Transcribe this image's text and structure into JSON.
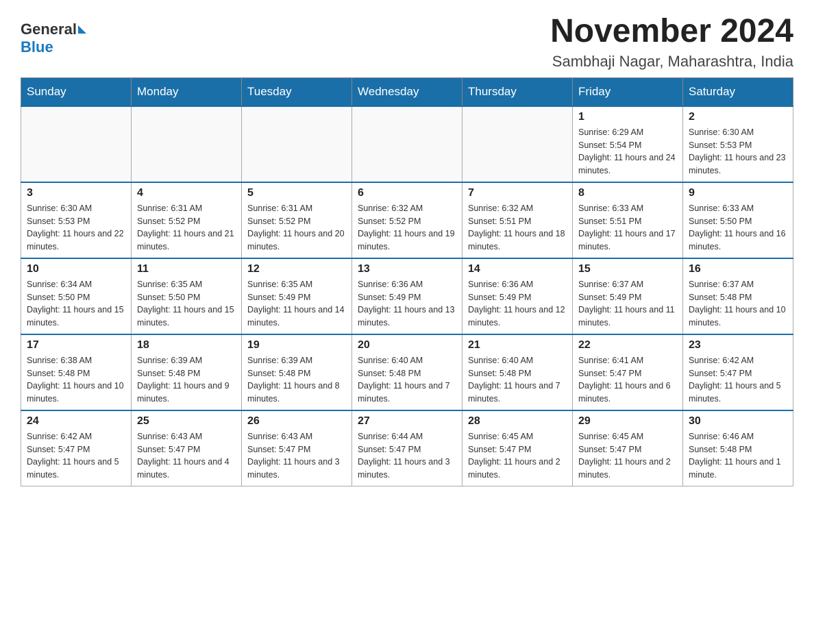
{
  "header": {
    "logo": {
      "general": "General",
      "triangle": "▶",
      "blue": "Blue"
    },
    "month_title": "November 2024",
    "location": "Sambhaji Nagar, Maharashtra, India"
  },
  "days_of_week": [
    "Sunday",
    "Monday",
    "Tuesday",
    "Wednesday",
    "Thursday",
    "Friday",
    "Saturday"
  ],
  "weeks": [
    [
      {
        "day": "",
        "info": ""
      },
      {
        "day": "",
        "info": ""
      },
      {
        "day": "",
        "info": ""
      },
      {
        "day": "",
        "info": ""
      },
      {
        "day": "",
        "info": ""
      },
      {
        "day": "1",
        "info": "Sunrise: 6:29 AM\nSunset: 5:54 PM\nDaylight: 11 hours and 24 minutes."
      },
      {
        "day": "2",
        "info": "Sunrise: 6:30 AM\nSunset: 5:53 PM\nDaylight: 11 hours and 23 minutes."
      }
    ],
    [
      {
        "day": "3",
        "info": "Sunrise: 6:30 AM\nSunset: 5:53 PM\nDaylight: 11 hours and 22 minutes."
      },
      {
        "day": "4",
        "info": "Sunrise: 6:31 AM\nSunset: 5:52 PM\nDaylight: 11 hours and 21 minutes."
      },
      {
        "day": "5",
        "info": "Sunrise: 6:31 AM\nSunset: 5:52 PM\nDaylight: 11 hours and 20 minutes."
      },
      {
        "day": "6",
        "info": "Sunrise: 6:32 AM\nSunset: 5:52 PM\nDaylight: 11 hours and 19 minutes."
      },
      {
        "day": "7",
        "info": "Sunrise: 6:32 AM\nSunset: 5:51 PM\nDaylight: 11 hours and 18 minutes."
      },
      {
        "day": "8",
        "info": "Sunrise: 6:33 AM\nSunset: 5:51 PM\nDaylight: 11 hours and 17 minutes."
      },
      {
        "day": "9",
        "info": "Sunrise: 6:33 AM\nSunset: 5:50 PM\nDaylight: 11 hours and 16 minutes."
      }
    ],
    [
      {
        "day": "10",
        "info": "Sunrise: 6:34 AM\nSunset: 5:50 PM\nDaylight: 11 hours and 15 minutes."
      },
      {
        "day": "11",
        "info": "Sunrise: 6:35 AM\nSunset: 5:50 PM\nDaylight: 11 hours and 15 minutes."
      },
      {
        "day": "12",
        "info": "Sunrise: 6:35 AM\nSunset: 5:49 PM\nDaylight: 11 hours and 14 minutes."
      },
      {
        "day": "13",
        "info": "Sunrise: 6:36 AM\nSunset: 5:49 PM\nDaylight: 11 hours and 13 minutes."
      },
      {
        "day": "14",
        "info": "Sunrise: 6:36 AM\nSunset: 5:49 PM\nDaylight: 11 hours and 12 minutes."
      },
      {
        "day": "15",
        "info": "Sunrise: 6:37 AM\nSunset: 5:49 PM\nDaylight: 11 hours and 11 minutes."
      },
      {
        "day": "16",
        "info": "Sunrise: 6:37 AM\nSunset: 5:48 PM\nDaylight: 11 hours and 10 minutes."
      }
    ],
    [
      {
        "day": "17",
        "info": "Sunrise: 6:38 AM\nSunset: 5:48 PM\nDaylight: 11 hours and 10 minutes."
      },
      {
        "day": "18",
        "info": "Sunrise: 6:39 AM\nSunset: 5:48 PM\nDaylight: 11 hours and 9 minutes."
      },
      {
        "day": "19",
        "info": "Sunrise: 6:39 AM\nSunset: 5:48 PM\nDaylight: 11 hours and 8 minutes."
      },
      {
        "day": "20",
        "info": "Sunrise: 6:40 AM\nSunset: 5:48 PM\nDaylight: 11 hours and 7 minutes."
      },
      {
        "day": "21",
        "info": "Sunrise: 6:40 AM\nSunset: 5:48 PM\nDaylight: 11 hours and 7 minutes."
      },
      {
        "day": "22",
        "info": "Sunrise: 6:41 AM\nSunset: 5:47 PM\nDaylight: 11 hours and 6 minutes."
      },
      {
        "day": "23",
        "info": "Sunrise: 6:42 AM\nSunset: 5:47 PM\nDaylight: 11 hours and 5 minutes."
      }
    ],
    [
      {
        "day": "24",
        "info": "Sunrise: 6:42 AM\nSunset: 5:47 PM\nDaylight: 11 hours and 5 minutes."
      },
      {
        "day": "25",
        "info": "Sunrise: 6:43 AM\nSunset: 5:47 PM\nDaylight: 11 hours and 4 minutes."
      },
      {
        "day": "26",
        "info": "Sunrise: 6:43 AM\nSunset: 5:47 PM\nDaylight: 11 hours and 3 minutes."
      },
      {
        "day": "27",
        "info": "Sunrise: 6:44 AM\nSunset: 5:47 PM\nDaylight: 11 hours and 3 minutes."
      },
      {
        "day": "28",
        "info": "Sunrise: 6:45 AM\nSunset: 5:47 PM\nDaylight: 11 hours and 2 minutes."
      },
      {
        "day": "29",
        "info": "Sunrise: 6:45 AM\nSunset: 5:47 PM\nDaylight: 11 hours and 2 minutes."
      },
      {
        "day": "30",
        "info": "Sunrise: 6:46 AM\nSunset: 5:48 PM\nDaylight: 11 hours and 1 minute."
      }
    ]
  ]
}
